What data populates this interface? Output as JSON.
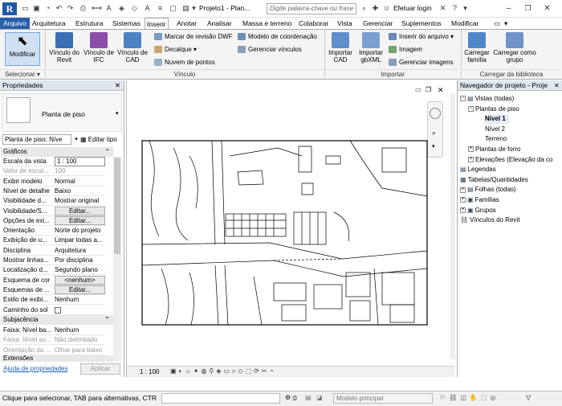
{
  "title_bar": {
    "logo": "R",
    "doc_title": "Projeto1 - Plan...",
    "search_placeholder": "Digite palavra-chave ou frase",
    "user": "Efetuar login"
  },
  "tabs": [
    {
      "label": "Arquivo"
    },
    {
      "label": "Arquitetura"
    },
    {
      "label": "Estrutura"
    },
    {
      "label": "Sistemas"
    },
    {
      "label": "Inserir"
    },
    {
      "label": "Anotar"
    },
    {
      "label": "Analisar"
    },
    {
      "label": "Massa e terreno"
    },
    {
      "label": "Colaborar"
    },
    {
      "label": "Vista"
    },
    {
      "label": "Gerenciar"
    },
    {
      "label": "Suplementos"
    },
    {
      "label": "Modificar"
    }
  ],
  "ribbon": {
    "modify": "Modificar",
    "select_panel": "Selecionar ▾",
    "link_revit": "Vínculo do Revit",
    "link_ifc": "Vínculo de IFC",
    "link_cad": "Vínculo de CAD",
    "markup_dwf": "Marcar de revisão DWF",
    "decal": "Decalque ▾",
    "point_cloud": "Nuvem de pontos",
    "coord_model": "Modelo de coordenação",
    "manage_links": "Gerenciar vínculos",
    "link_panel": "Vínculo",
    "import_cad": "Importar CAD",
    "import_gbxml": "Importar gbXML",
    "insert_from_file": "Inserir do arquivo ▾",
    "image": "Imagem",
    "manage_images": "Gerenciar imagens",
    "import_panel": "Importar",
    "load_family": "Carregar família",
    "load_as_group": "Carregar como grupo",
    "library_panel": "Carregar da biblioteca"
  },
  "properties": {
    "header": "Propriedades",
    "type_name": "Planta de piso",
    "selector": "Planta de piso: Níve",
    "edit_type": "Editar tipo",
    "groups": {
      "graphics": "Gráficos",
      "underlay": "Subjacência",
      "extents": "Extensões"
    },
    "rows": [
      {
        "k": "Escala da vista",
        "v": "1 : 100"
      },
      {
        "k": "Valor de escal...",
        "v": "100"
      },
      {
        "k": "Exibir modelo",
        "v": "Normal"
      },
      {
        "k": "Nível de detalhe",
        "v": "Baixo"
      },
      {
        "k": "Visibilidade d...",
        "v": "Mostrar original"
      },
      {
        "k": "Visibilidade/S...",
        "v": "Editar..."
      },
      {
        "k": "Opções de exi...",
        "v": "Editar..."
      },
      {
        "k": "Orientação",
        "v": "Norte do projeto"
      },
      {
        "k": "Exibição de u...",
        "v": "Limpar todas a..."
      },
      {
        "k": "Disciplina",
        "v": "Arquitetura"
      },
      {
        "k": "Mostrar linhas...",
        "v": "Por disciplina"
      },
      {
        "k": "Localização d...",
        "v": "Segundo plano"
      },
      {
        "k": "Esquema de cor",
        "v": "<nenhum>"
      },
      {
        "k": "Esquemas de ...",
        "v": "Editar..."
      },
      {
        "k": "Estilo de exibi...",
        "v": "Nenhum"
      },
      {
        "k": "Caminho do sol",
        "v": ""
      }
    ],
    "underlay_rows": [
      {
        "k": "Faixa: Nível ba...",
        "v": "Nenhum"
      },
      {
        "k": "Faixa: Nível su...",
        "v": "Não delimitado"
      },
      {
        "k": "Orientação da ...",
        "v": "Olhar para baixo"
      }
    ],
    "help_link": "Ajuda de propriedades",
    "apply": "Aplicar"
  },
  "browser": {
    "header": "Navegador de projeto - Proje",
    "nodes": [
      {
        "label": "Vistas (todas)"
      },
      {
        "label": "Plantas de piso"
      },
      {
        "label": "Nível 1"
      },
      {
        "label": "Nível 2"
      },
      {
        "label": "Terreno"
      },
      {
        "label": "Plantas de forro"
      },
      {
        "label": "Elevações (Elevação da co"
      },
      {
        "label": "Legendas"
      },
      {
        "label": "Tabelas/Quantidades"
      },
      {
        "label": "Folhas (todas)"
      },
      {
        "label": "Famílias"
      },
      {
        "label": "Grupos"
      },
      {
        "label": "Vínculos do Revit"
      }
    ]
  },
  "view": {
    "scale": "1 : 100"
  },
  "status": {
    "hint": "Clique para selecionar, TAB para alternativas, CTR",
    "zero": ":0",
    "model": "Modelo principal"
  },
  "colors": {
    "accent": "#2a5fa9",
    "panel_header": "#dfe6ee"
  }
}
